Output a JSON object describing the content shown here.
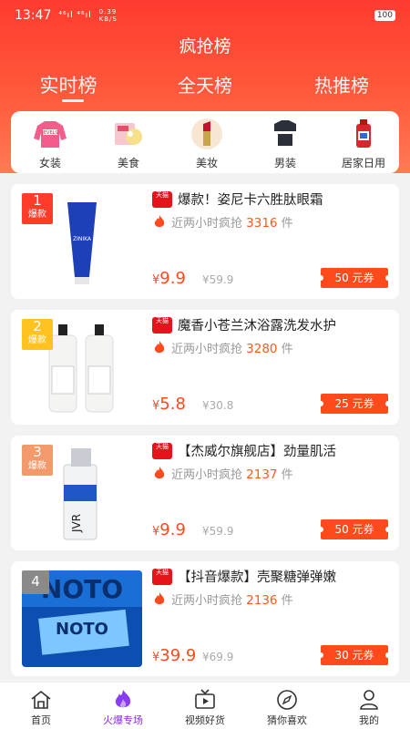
{
  "status": {
    "time": "13:47",
    "signal": "⁴⁶ıl ⁴⁶ıl",
    "net_speed": "0.39 KB/S",
    "battery": "100"
  },
  "header": {
    "title": "疯抢榜"
  },
  "tabs": [
    {
      "label": "实时榜",
      "active": true
    },
    {
      "label": "全天榜"
    },
    {
      "label": "热推榜"
    }
  ],
  "categories": [
    {
      "label": "女装",
      "icon": "sweater-icon"
    },
    {
      "label": "美食",
      "icon": "food-icon"
    },
    {
      "label": "美妆",
      "icon": "lipstick-icon"
    },
    {
      "label": "男装",
      "icon": "shirt-icon"
    },
    {
      "label": "居家日用",
      "icon": "detergent-icon"
    }
  ],
  "products": [
    {
      "rank": "1",
      "rank_tag": "爆款",
      "shop_badge": "天猫",
      "title": "爆款！姿尼卡六胜肽眼霜",
      "hot_prefix": "近两小时疯抢",
      "hot_count": "3316",
      "hot_unit": "件",
      "price_symbol": "¥",
      "price": "9.9",
      "orig_price": "¥59.9",
      "coupon": "50 元券"
    },
    {
      "rank": "2",
      "rank_tag": "爆款",
      "shop_badge": "天猫",
      "title": "魔香小苍兰沐浴露洗发水护",
      "hot_prefix": "近两小时疯抢",
      "hot_count": "3280",
      "hot_unit": "件",
      "price_symbol": "¥",
      "price": "5.8",
      "orig_price": "¥30.8",
      "coupon": "25 元券"
    },
    {
      "rank": "3",
      "rank_tag": "爆款",
      "shop_badge": "天猫",
      "title": "【杰威尔旗舰店】劲量肌活",
      "hot_prefix": "近两小时疯抢",
      "hot_count": "2137",
      "hot_unit": "件",
      "price_symbol": "¥",
      "price": "9.9",
      "orig_price": "¥59.9",
      "coupon": "50 元券"
    },
    {
      "rank": "4",
      "rank_tag": "",
      "shop_badge": "天猫",
      "title": "【抖音爆款】壳聚糖弹弹嫩",
      "hot_prefix": "近两小时疯抢",
      "hot_count": "2136",
      "hot_unit": "件",
      "price_symbol": "¥",
      "price": "39.9",
      "orig_price": "¥69.9",
      "coupon": "30 元券"
    }
  ],
  "bottom_nav": [
    {
      "label": "首页",
      "icon": "home-icon"
    },
    {
      "label": "火爆专场",
      "icon": "flame-icon",
      "active": true
    },
    {
      "label": "视频好货",
      "icon": "tv-icon"
    },
    {
      "label": "猜你喜欢",
      "icon": "compass-icon"
    },
    {
      "label": "我的",
      "icon": "person-icon"
    }
  ]
}
